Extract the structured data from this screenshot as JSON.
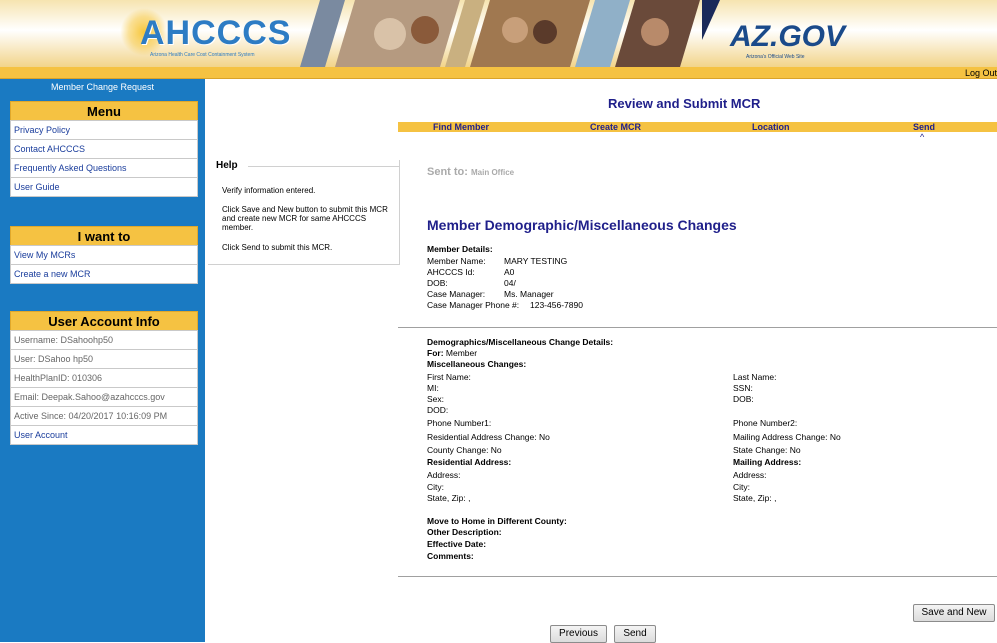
{
  "banner": {
    "logo_text": "AHCCCS",
    "logo_subtitle": "Arizona Health Care Cost Containment System",
    "azgov_text": "AZ.GOV",
    "azgov_subtitle": "Arizona's Official Web Site"
  },
  "topbar": {
    "logout_label": "Log Out"
  },
  "sidebar": {
    "title": "Member Change Request",
    "menu": {
      "header": "Menu",
      "items": [
        "Privacy Policy",
        "Contact AHCCCS",
        "Frequently Asked Questions",
        "User Guide"
      ]
    },
    "iwant": {
      "header": "I want to",
      "items": [
        "View My MCRs",
        "Create a new MCR"
      ]
    },
    "account": {
      "header": "User Account Info",
      "username": "Username: DSahoohp50",
      "user": "User: DSahoo hp50",
      "healthplan": "HealthPlanID: 010306",
      "email": "Email: Deepak.Sahoo@azahcccs.gov",
      "active_since": "Active Since: 04/20/2017 10:16:09 PM",
      "link": "User Account"
    }
  },
  "main": {
    "title": "Review and Submit MCR",
    "steps": [
      "Find Member",
      "Create MCR",
      "Location",
      "Send"
    ],
    "current_step_marker": "^",
    "help": {
      "title": "Help",
      "lines": [
        "Verify information entered.",
        "Click Save and New button to submit this MCR and create new MCR for same AHCCCS member.",
        "Click Send to submit this MCR."
      ]
    },
    "sent_to_label": "Sent to:",
    "sent_to_value": "Main Office",
    "section_title": "Member Demographic/Miscellaneous Changes",
    "member_details": {
      "heading": "Member Details:",
      "name_label": "Member Name:",
      "name_value": "MARY TESTING",
      "id_label": "AHCCCS Id:",
      "id_value": "A0",
      "dob_label": "DOB:",
      "dob_value": "04/",
      "cm_label": "Case Manager:",
      "cm_value": "Ms. Manager",
      "cm_phone_label": "Case Manager Phone #:",
      "cm_phone_value": "123-456-7890"
    },
    "changes": {
      "heading": "Demographics/Miscellaneous Change Details:",
      "for_label": "For:",
      "for_value": "Member",
      "misc_heading": "Miscellaneous Changes:",
      "left": {
        "first_name": "First Name:",
        "mi": "MI:",
        "sex": "Sex:",
        "dod": "DOD:",
        "phone1": "Phone Number1:",
        "res_change": "Residential Address Change: No",
        "county_change": "County Change: No",
        "res_heading": "Residential Address:",
        "address": "Address:",
        "city": "City:",
        "state_zip": "State, Zip: ,"
      },
      "right": {
        "last_name": "Last Name:",
        "ssn": "SSN:",
        "dob": "DOB:",
        "phone2": "Phone Number2:",
        "mail_change": "Mailing Address Change: No",
        "state_change": "State Change: No",
        "mail_heading": "Mailing Address:",
        "address": "Address:",
        "city": "City:",
        "state_zip": "State, Zip: ,"
      },
      "move_county": "Move to Home in Different County:",
      "other_desc": "Other Description:",
      "effective_date": "Effective Date:",
      "comments": "Comments:"
    },
    "buttons": {
      "save_new": "Save and New",
      "previous": "Previous",
      "send": "Send"
    }
  }
}
